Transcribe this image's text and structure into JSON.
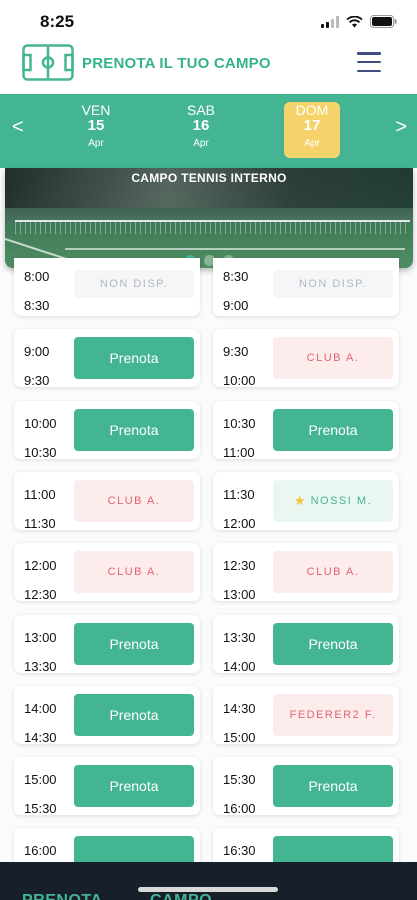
{
  "status_bar": {
    "time": "8:25"
  },
  "header": {
    "title": "PRENOTA IL TUO CAMPO"
  },
  "date_strip": {
    "prev_arrow": "<",
    "next_arrow": ">",
    "days": [
      {
        "name": "VEN",
        "num": "15",
        "month": "Apr"
      },
      {
        "name": "SAB",
        "num": "16",
        "month": "Apr"
      },
      {
        "name": "DOM",
        "num": "17",
        "month": "Apr"
      }
    ]
  },
  "banner": {
    "title": "CAMPO TENNIS INTERNO"
  },
  "slots": [
    {
      "start": "8:00",
      "end": "8:30",
      "label": "NON DISP.",
      "kind": "na"
    },
    {
      "start": "8:30",
      "end": "9:00",
      "label": "NON DISP.",
      "kind": "na"
    },
    {
      "start": "9:00",
      "end": "9:30",
      "label": "Prenota",
      "kind": "book"
    },
    {
      "start": "9:30",
      "end": "10:00",
      "label": "CLUB A.",
      "kind": "club"
    },
    {
      "start": "10:00",
      "end": "10:30",
      "label": "Prenota",
      "kind": "book"
    },
    {
      "start": "10:30",
      "end": "11:00",
      "label": "Prenota",
      "kind": "book"
    },
    {
      "start": "11:00",
      "end": "11:30",
      "label": "CLUB A.",
      "kind": "club"
    },
    {
      "start": "11:30",
      "end": "12:00",
      "label": "NOSSI M.",
      "kind": "member"
    },
    {
      "start": "12:00",
      "end": "12:30",
      "label": "CLUB A.",
      "kind": "club"
    },
    {
      "start": "12:30",
      "end": "13:00",
      "label": "CLUB A.",
      "kind": "club"
    },
    {
      "start": "13:00",
      "end": "13:30",
      "label": "Prenota",
      "kind": "book"
    },
    {
      "start": "13:30",
      "end": "14:00",
      "label": "Prenota",
      "kind": "book"
    },
    {
      "start": "14:00",
      "end": "14:30",
      "label": "Prenota",
      "kind": "book"
    },
    {
      "start": "14:30",
      "end": "15:00",
      "label": "FEDERER2 F.",
      "kind": "club"
    },
    {
      "start": "15:00",
      "end": "15:30",
      "label": "Prenota",
      "kind": "book"
    },
    {
      "start": "15:30",
      "end": "16:00",
      "label": "Prenota",
      "kind": "book"
    },
    {
      "start": "16:00",
      "end": "",
      "label": "",
      "kind": "book"
    },
    {
      "start": "16:30",
      "end": "",
      "label": "",
      "kind": "book"
    }
  ],
  "tabbar": {
    "tab1": "PRENOTA",
    "tab2": "CAMPO"
  },
  "colors": {
    "accent": "#43b592",
    "club": "#e06470",
    "selected_day": "#f6d36a",
    "tabbar": "#17202a"
  },
  "icons": [
    "field-logo-icon",
    "menu-icon",
    "signal-icon",
    "wifi-icon",
    "battery-icon",
    "star-icon"
  ]
}
